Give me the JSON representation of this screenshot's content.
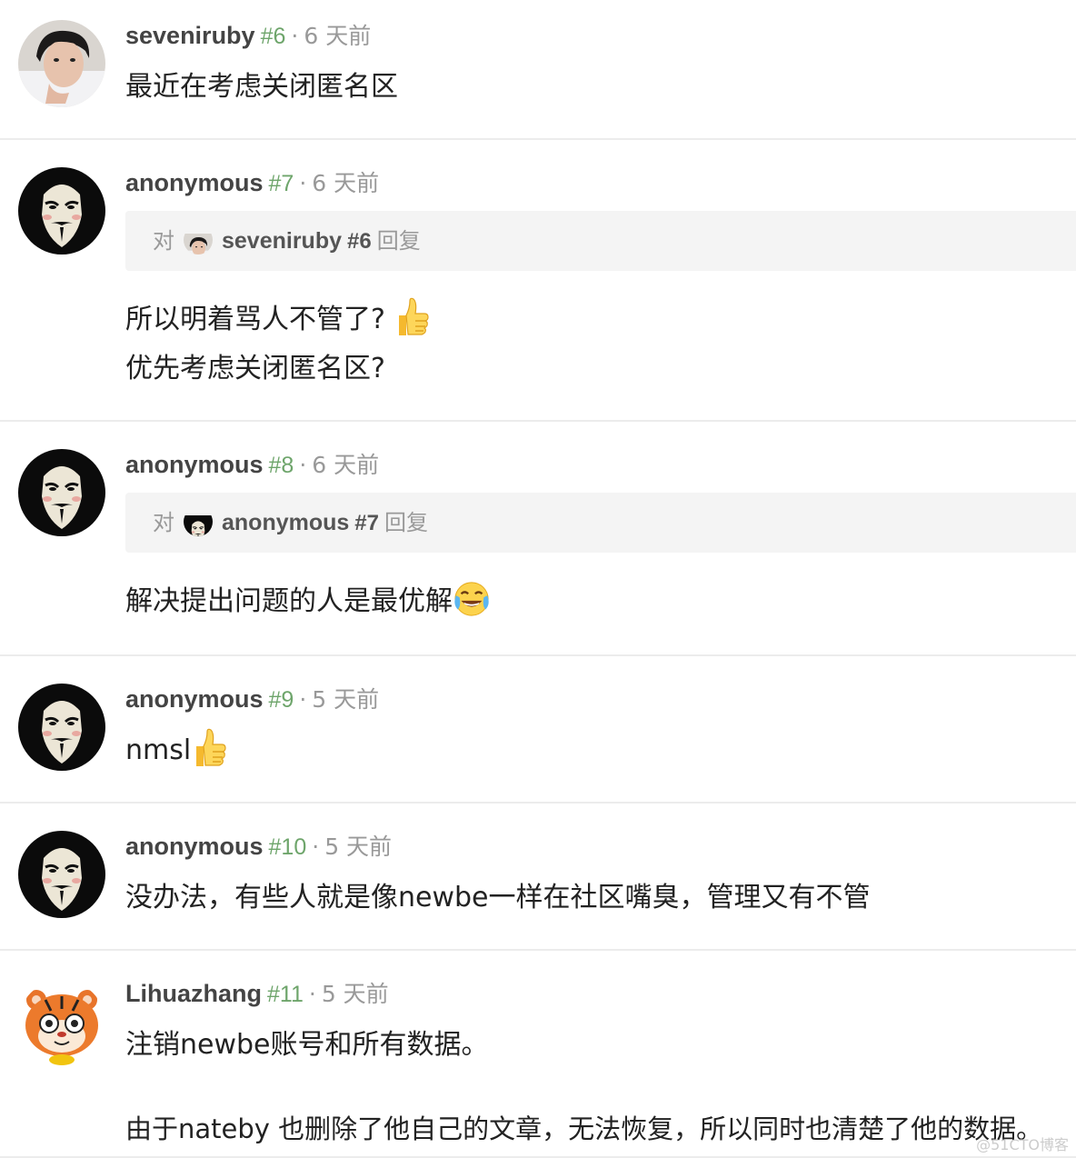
{
  "posts": [
    {
      "user": "seveniruby",
      "number": "#6",
      "separator": "·",
      "time": "6 天前",
      "lines": [
        "最近在考虑关闭匿名区"
      ]
    },
    {
      "user": "anonymous",
      "number": "#7",
      "separator": "·",
      "time": "6 天前",
      "reply": {
        "prefix": "对",
        "user": "seveniruby",
        "number": "#6",
        "suffix": "回复"
      },
      "lines": [
        "所以明着骂人不管了?",
        "优先考虑关闭匿名区?"
      ]
    },
    {
      "user": "anonymous",
      "number": "#8",
      "separator": "·",
      "time": "6 天前",
      "reply": {
        "prefix": "对",
        "user": "anonymous",
        "number": "#7",
        "suffix": "回复"
      },
      "lines": [
        "解决提出问题的人是最优解"
      ]
    },
    {
      "user": "anonymous",
      "number": "#9",
      "separator": "·",
      "time": "5 天前",
      "lines": [
        "nmsl"
      ]
    },
    {
      "user": "anonymous",
      "number": "#10",
      "separator": "·",
      "time": "5 天前",
      "lines": [
        "没办法，有些人就是像newbe一样在社区嘴臭，管理又有不管"
      ]
    },
    {
      "user": "Lihuazhang",
      "number": "#11",
      "separator": "·",
      "time": "5 天前",
      "lines": [
        "注销newbe账号和所有数据。",
        "由于nateby 也删除了他自己的文章，无法恢复，所以同时也清楚了他的数据。"
      ]
    }
  ],
  "icons": {
    "thumbs_up": "thumbs-up-emoji",
    "tears_of_joy": "tears-of-joy-emoji",
    "mask_avatar": "guy-fawkes-mask-avatar",
    "tiger_avatar": "tiger-avatar",
    "photo_avatar": "user-photo-avatar"
  },
  "colors": {
    "post_number": "#6ea56b",
    "meta_gray": "#999999",
    "reply_bg": "#f4f4f4",
    "divider": "#ececec"
  },
  "watermark": "@51CTO博客"
}
